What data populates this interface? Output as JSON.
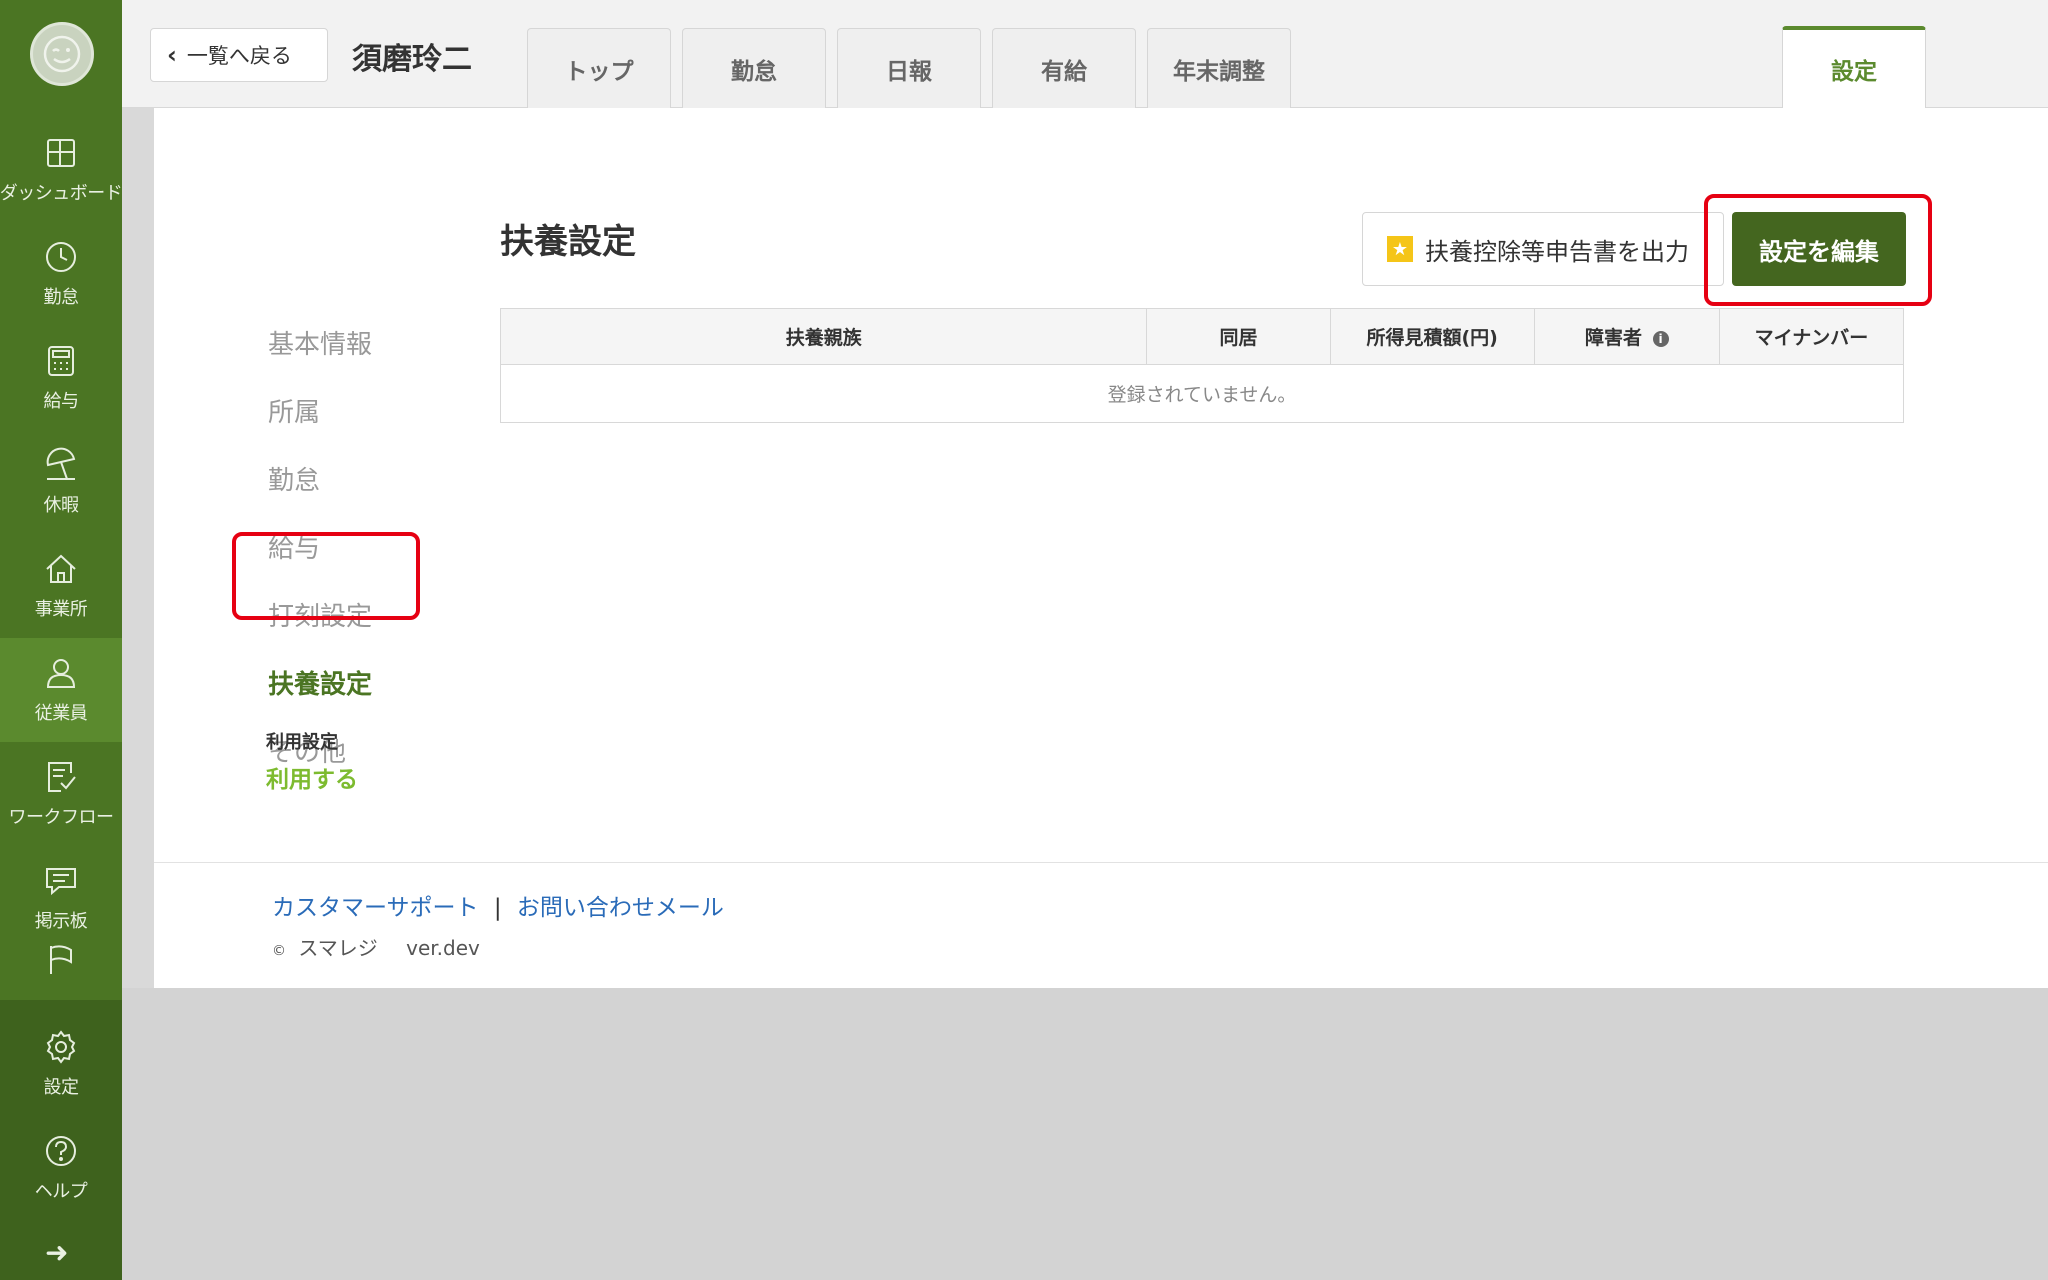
{
  "sidebar": {
    "items": [
      {
        "label": "ダッシュボード",
        "icon": "dashboard-icon"
      },
      {
        "label": "勤怠",
        "icon": "clock-icon"
      },
      {
        "label": "給与",
        "icon": "calculator-icon"
      },
      {
        "label": "休暇",
        "icon": "beach-umbrella-icon"
      },
      {
        "label": "事業所",
        "icon": "home-icon"
      },
      {
        "label": "従業員",
        "icon": "person-icon"
      },
      {
        "label": "ワークフロー",
        "icon": "clipboard-check-icon"
      },
      {
        "label": "掲示板",
        "icon": "message-icon"
      },
      {
        "label": "",
        "icon": "flag-icon"
      },
      {
        "label": "設定",
        "icon": "gear-icon"
      },
      {
        "label": "ヘルプ",
        "icon": "help-icon"
      }
    ],
    "active_index": 5
  },
  "header": {
    "back_label": "一覧へ戻る",
    "user_name": "須磨玲二",
    "tabs": [
      {
        "label": "トップ"
      },
      {
        "label": "勤怠"
      },
      {
        "label": "日報"
      },
      {
        "label": "有給"
      },
      {
        "label": "年末調整"
      },
      {
        "label": "設定"
      }
    ],
    "active_tab": "設定"
  },
  "subnav": {
    "items": [
      {
        "label": "基本情報"
      },
      {
        "label": "所属"
      },
      {
        "label": "勤怠"
      },
      {
        "label": "給与"
      },
      {
        "label": "打刻設定"
      },
      {
        "label": "扶養設定"
      },
      {
        "label": "その他"
      }
    ],
    "active": "扶養設定",
    "usage_label": "利用設定",
    "usage_value": "利用する"
  },
  "section": {
    "title": "扶養設定",
    "export_label": "扶養控除等申告書を出力",
    "edit_label": "設定を編集"
  },
  "table": {
    "headers": [
      "扶養親族",
      "同居",
      "所得見積額(円)",
      "障害者",
      "マイナンバー"
    ],
    "empty_message": "登録されていません。"
  },
  "footer": {
    "support_link": "カスタマーサポート",
    "separator": "|",
    "contact_link": "お問い合わせメール",
    "copyright": "スマレジ",
    "copyright_symbol": "©",
    "version": "ver.dev"
  },
  "colors": {
    "sidebar": "#4b7523",
    "accent": "#5b8a2e",
    "primary_button": "#44661f",
    "highlight": "#e60012",
    "link": "#2a6bb8"
  }
}
